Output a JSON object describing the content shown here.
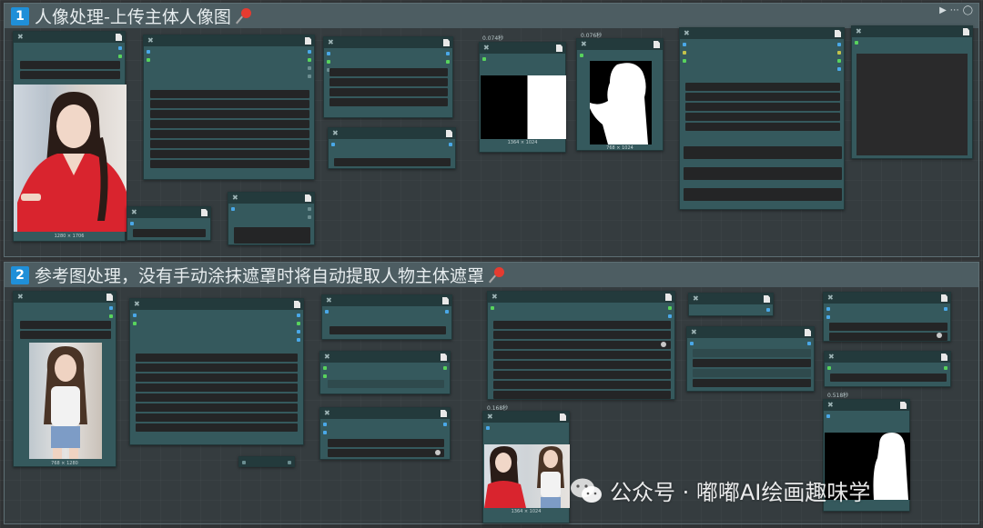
{
  "groups": [
    {
      "number": "1",
      "title": "人像处理-上传主体人像图"
    },
    {
      "number": "2",
      "title": "参考图处理，没有手动涂抹遮罩时将自动提取人物主体遮罩"
    }
  ],
  "group_tools": {
    "play": "▶",
    "more": "⋯",
    "circle": "◯"
  },
  "node_close": "✖",
  "time_labels": {
    "split_preview": "0.074秒",
    "mask_preview": "0.076秒",
    "ref_collage": "0.168秒",
    "ref_mask": "0.518秒"
  },
  "captions": {
    "portrait_upload": "1280 × 1706",
    "split_preview": "1364 × 1024",
    "mask_preview": "768 × 1024",
    "ref_upload": "768 × 1280",
    "ref_collage": "1364 × 1024"
  },
  "watermark": {
    "text": "公众号 · 嘟嘟AI绘画趣味学"
  },
  "colors": {
    "group_accent": "#1f8fd8",
    "node_body": "#35595d",
    "node_header": "#233a3c",
    "pin": "#e53b30"
  }
}
